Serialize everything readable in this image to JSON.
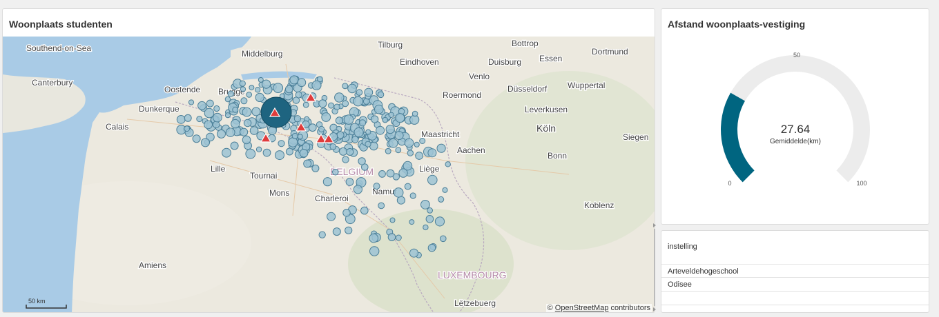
{
  "map_panel": {
    "title": "Woonplaats studenten",
    "scale_label": "50 km",
    "attribution_symbol": "©",
    "attribution_link": "OpenStreetMap",
    "attribution_suffix": "contributors",
    "place_labels": [
      "Southend-on-Sea",
      "Tilburg",
      "Bottrop",
      "Essen",
      "Dortmund",
      "Middelburg",
      "Eindhoven",
      "Duisburg",
      "Canterbury",
      "Venlo",
      "Wuppertal",
      "Oostende",
      "Brugge",
      "Roermond",
      "Düsseldorf",
      "Dunkerque",
      "Leverkusen",
      "Calais",
      "Köln",
      "Maastricht",
      "Siegen",
      "Aachen",
      "Bonn",
      "Lille",
      "Tournai",
      "BELGIUM",
      "Liège",
      "Mons",
      "Charleroi",
      "Namur",
      "Koblenz",
      "Amiens",
      "LUXEMBOURG",
      "Lëtzebuerg"
    ],
    "colors": {
      "sea": "#a9cbe6",
      "land": "#efece4",
      "marker_fill": "#9dc3d3",
      "marker_stroke": "#4b7f98",
      "big_marker": "#1e6480",
      "campus": "#e03c3c"
    }
  },
  "gauge_panel": {
    "title": "Afstand woonplaats-vestiging",
    "value": "27.64",
    "value_numeric": 27.64,
    "min": 0,
    "max": 100,
    "tick_mid": "50",
    "tick_min": "0",
    "tick_max": "100",
    "label": "Gemiddelde(km)",
    "colors": {
      "fill": "#006580",
      "track": "#ececec"
    }
  },
  "filter_panel": {
    "title": "instelling",
    "items": [
      "Arteveldehogeschool",
      "Odisee"
    ]
  }
}
